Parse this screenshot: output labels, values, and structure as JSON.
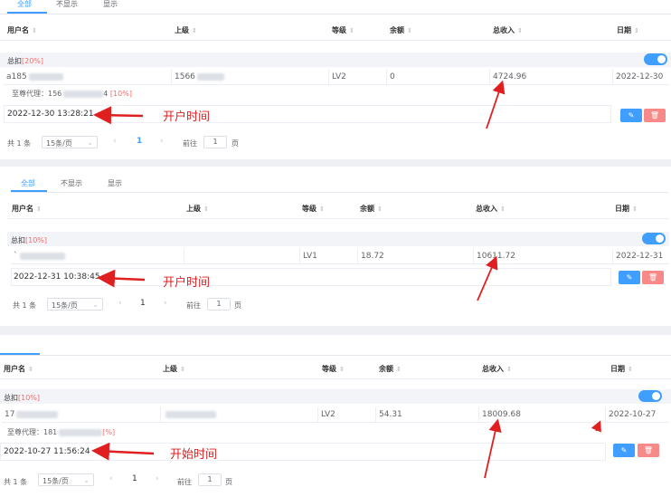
{
  "tabs": {
    "all": "全部",
    "hidden": "不显示",
    "shown": "显示"
  },
  "columns": {
    "username": "用户名",
    "superior": "上级",
    "level": "等级",
    "balance": "余额",
    "total_income": "总收入",
    "date": "日期"
  },
  "sort_icon": "⇕",
  "pagination": {
    "total": "共 1 条",
    "page_size": "15条/页",
    "page": "1",
    "goto": "前往",
    "goto_page": "1",
    "page_unit": "页"
  },
  "panels": [
    {
      "deduct_label": "总扣",
      "deduct_pct": "[20%]",
      "row": {
        "username": "a185",
        "superior": "1566",
        "level": "LV2",
        "balance": "0",
        "total_income": "4724.96",
        "date": "2022-12-30"
      },
      "agent_prefix": "至尊代理：156",
      "agent_suffix": "4",
      "agent_pct": "[10%]",
      "time": "2022-12-30 13:28:21",
      "annotation": "开户时间"
    },
    {
      "deduct_label": "总扣",
      "deduct_pct": "[10%]",
      "row": {
        "username": "`",
        "superior": "",
        "level": "LV1",
        "balance": "18.72",
        "total_income": "10611.72",
        "date": "2022-12-31"
      },
      "time": "2022-12-31 10:38:45",
      "annotation": "开户时间"
    },
    {
      "deduct_label": "总扣",
      "deduct_pct": "[10%]",
      "row": {
        "username": "17",
        "superior": "",
        "level": "LV2",
        "balance": "54.31",
        "total_income": "18009.68",
        "date": "2022-10-27"
      },
      "agent_prefix": "至尊代理：181",
      "agent_pct": "[%]",
      "time": "2022-10-27 11:56:24",
      "annotation": "开始时间"
    }
  ],
  "colors": {
    "primary": "#409eff",
    "danger": "#f56c6c",
    "annotation": "#e02020"
  },
  "icons": {
    "edit": "edit-icon",
    "delete": "delete-icon"
  }
}
